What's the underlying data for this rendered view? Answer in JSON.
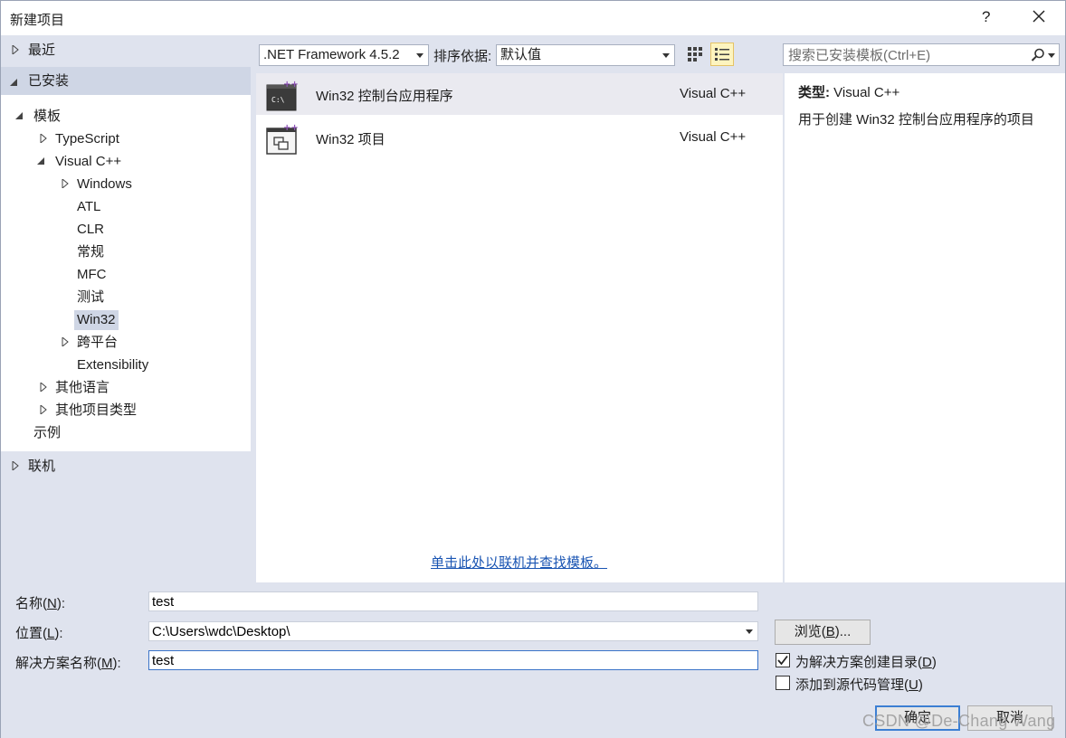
{
  "window": {
    "title": "新建项目",
    "help": "?"
  },
  "tree": {
    "recent": "最近",
    "installed": "已安装",
    "templates": "模板",
    "typescript": "TypeScript",
    "visual_cpp": "Visual C++",
    "windows": "Windows",
    "atl": "ATL",
    "clr": "CLR",
    "general": "常规",
    "mfc": "MFC",
    "test": "测试",
    "win32": "Win32",
    "cross_platform": "跨平台",
    "extensibility": "Extensibility",
    "other_languages": "其他语言",
    "other_project_types": "其他项目类型",
    "samples": "示例",
    "online": "联机"
  },
  "toolbar": {
    "framework": ".NET Framework 4.5.2",
    "sort_label": "排序依据:",
    "sort_value": "默认值",
    "search_placeholder": "搜索已安装模板(Ctrl+E)"
  },
  "templates": [
    {
      "name": "Win32 控制台应用程序",
      "lang": "Visual C++",
      "icon": "console-app-icon",
      "selected": true
    },
    {
      "name": "Win32 项目",
      "lang": "Visual C++",
      "icon": "win32-project-icon",
      "selected": false
    }
  ],
  "online_link": "单击此处以联机并查找模板。",
  "detail": {
    "type_label": "类型:",
    "type_value": "Visual C++",
    "description": "用于创建 Win32 控制台应用程序的项目"
  },
  "form": {
    "name_label_pre": "名称(",
    "name_label_key": "N",
    "name_label_post": "):",
    "name_value": "test",
    "location_label_pre": "位置(",
    "location_label_key": "L",
    "location_label_post": "):",
    "location_value": "C:\\Users\\wdc\\Desktop\\",
    "solution_label_pre": "解决方案名称(",
    "solution_label_key": "M",
    "solution_label_post": "):",
    "solution_value": "test",
    "browse_pre": "浏览(",
    "browse_key": "B",
    "browse_post": ")...",
    "create_dir_pre": "为解决方案创建目录(",
    "create_dir_key": "D",
    "create_dir_post": ")",
    "create_dir_checked": true,
    "source_control_pre": "添加到源代码管理(",
    "source_control_key": "U",
    "source_control_post": ")",
    "source_control_checked": false,
    "ok": "确定",
    "cancel": "取消"
  },
  "watermark": "CSDN @De-Chang Wang",
  "colors": {
    "accent": "#3c7fd3",
    "link": "#1a55b3",
    "panel": "#dfe3ee",
    "selection": "#cfd6e5"
  }
}
